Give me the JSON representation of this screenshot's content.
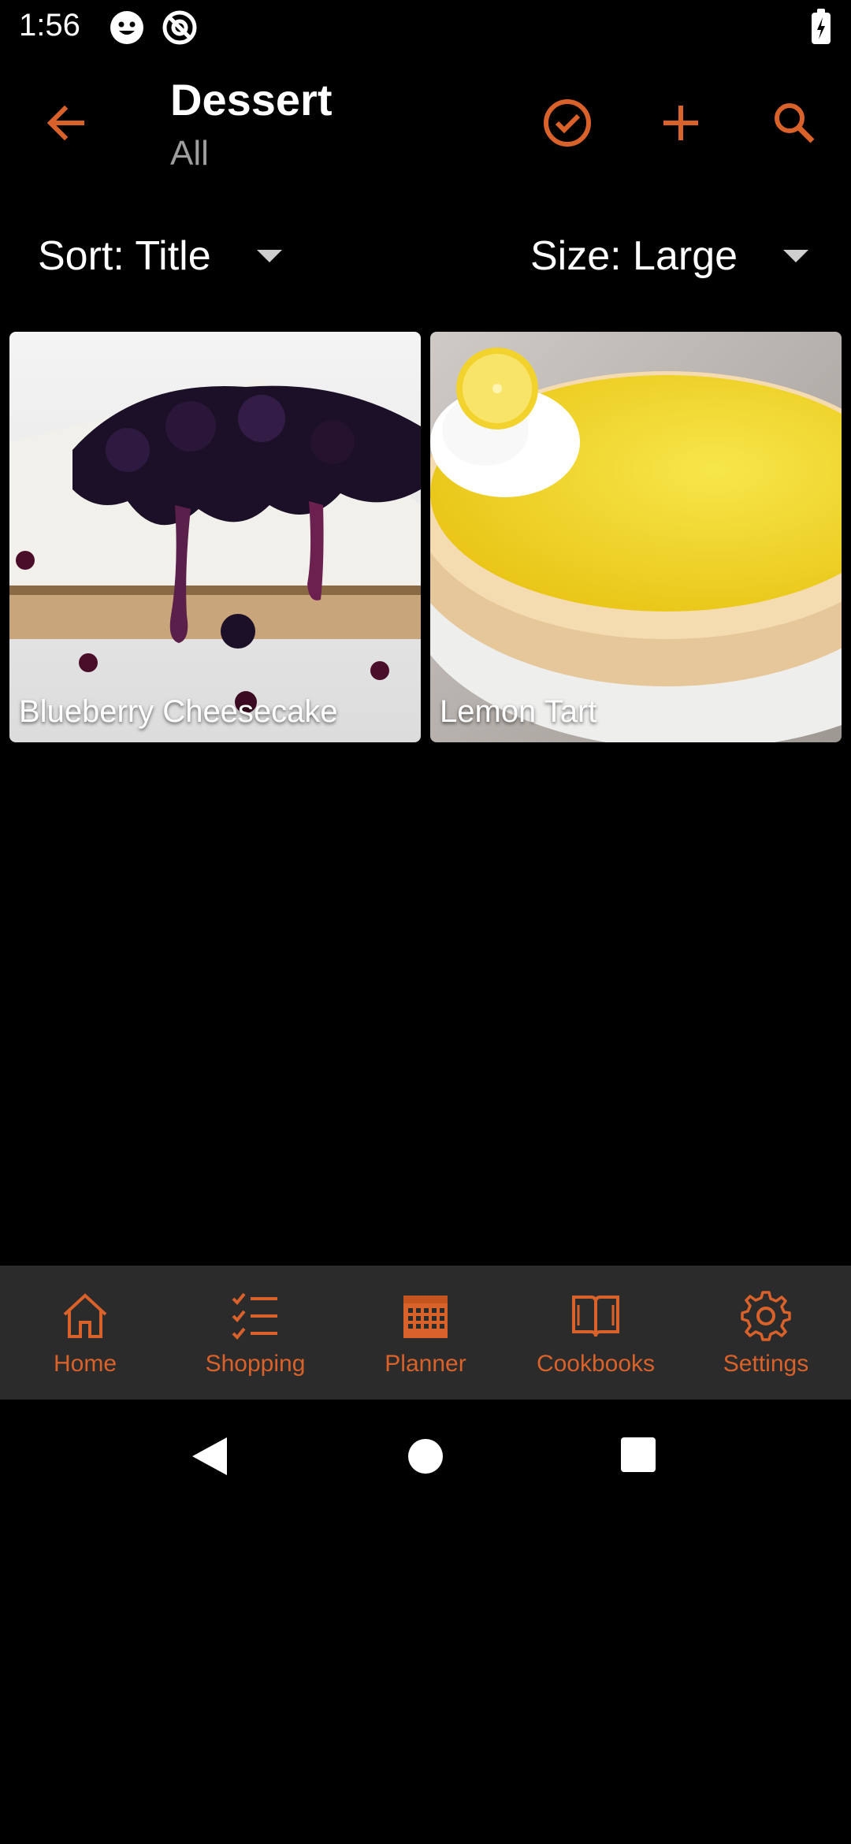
{
  "status_bar": {
    "time": "1:56",
    "icons": [
      "smiley-icon",
      "at-sign-icon",
      "battery-charging-icon"
    ]
  },
  "app_bar": {
    "title": "Dessert",
    "subtitle": "All",
    "actions": [
      "back-arrow-icon",
      "check-circle-icon",
      "plus-icon",
      "search-icon"
    ],
    "accent_color": "#d9622b"
  },
  "controls": {
    "sort_label": "Sort: Title",
    "size_label": "Size: Large"
  },
  "recipes": [
    {
      "title": "Blueberry Cheesecake"
    },
    {
      "title": "Lemon Tart"
    }
  ],
  "bottom_nav": {
    "items": [
      {
        "label": "Home",
        "icon": "home-icon"
      },
      {
        "label": "Shopping",
        "icon": "checklist-icon"
      },
      {
        "label": "Planner",
        "icon": "calendar-icon"
      },
      {
        "label": "Cookbooks",
        "icon": "book-icon"
      },
      {
        "label": "Settings",
        "icon": "gear-icon"
      }
    ]
  },
  "system_nav": [
    "back-triangle-icon",
    "home-circle-icon",
    "recents-square-icon"
  ]
}
